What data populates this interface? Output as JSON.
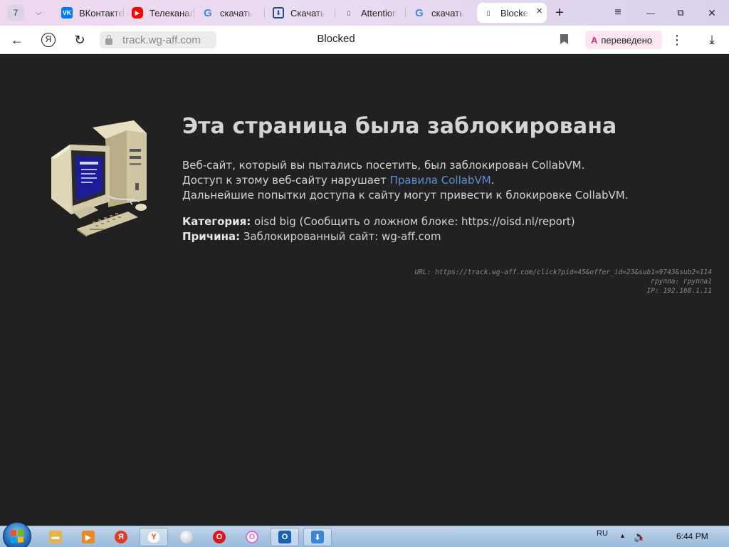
{
  "browser": {
    "tab_count": "7",
    "tabs": [
      {
        "title": "ВКонтакте",
        "icon": "vk-icon",
        "favicon_text": "VK"
      },
      {
        "title": "Телеканал",
        "icon": "youtube-icon",
        "favicon_text": "▶"
      },
      {
        "title": "скачать",
        "icon": "google-icon",
        "favicon_text": "G"
      },
      {
        "title": "Скачать",
        "icon": "download-site-icon",
        "favicon_text": "⬇"
      },
      {
        "title": "Attention",
        "icon": "page-icon",
        "favicon_text": "▯"
      },
      {
        "title": "скачать",
        "icon": "google-icon",
        "favicon_text": "G"
      },
      {
        "title": "Blocked",
        "icon": "page-icon",
        "favicon_text": "▯",
        "active": true
      }
    ],
    "new_tab_glyph": "+",
    "window_controls": {
      "menu": "≡",
      "minimize": "—",
      "restore": "⧉",
      "close": "✕"
    }
  },
  "addressbar": {
    "back": "←",
    "yandex": "Я",
    "reload": "↻",
    "host": "track.wg-aff.com",
    "page_title": "Blocked",
    "translate_badge": "переведено",
    "translate_icon": "A",
    "more": "⋮",
    "download": "⤓"
  },
  "page": {
    "title": "Эта страница была заблокирована",
    "line1": "Веб-сайт, который вы пытались посетить, был заблокирован CollabVM.",
    "line2_prefix": "Доступ к этому веб-сайту нарушает ",
    "line2_link": "Правила CollabVM",
    "line2_suffix": ".",
    "line3": "Дальнейшие попытки доступа к сайту могут привести к блокировке CollabVM.",
    "category_label": "Категория:",
    "category_value": " oisd big (Сообщить о ложном блоке: https://oisd.nl/report)",
    "reason_label": "Причина:",
    "reason_value": " Заблокированный сайт: wg-aff.com",
    "debug": {
      "url": "URL: https://track.wg-aff.com/click?pid=45&offer_id=23&sub1=9743&sub2=114",
      "group": "группа: группа1",
      "ip": "IP: 192.168.1.11"
    }
  },
  "taskbar": {
    "items": [
      {
        "name": "explorer",
        "icon": "folder-icon",
        "color": "#e8b24a",
        "glyph": "▬"
      },
      {
        "name": "media-player",
        "icon": "media-player-icon",
        "color": "#e98a22",
        "glyph": "▶"
      },
      {
        "name": "yandex-red",
        "icon": "yandex-icon",
        "color": "#e23a2b",
        "glyph": "Я"
      },
      {
        "name": "yandex-browser",
        "icon": "yandex-browser-icon",
        "color": "#ff3a2b",
        "glyph": "Y"
      },
      {
        "name": "generic-circle",
        "icon": "circle-app-icon",
        "color": "#c8ccd2",
        "glyph": "●"
      },
      {
        "name": "opera",
        "icon": "opera-icon",
        "color": "#e0141e",
        "glyph": "O"
      },
      {
        "name": "opera-gx",
        "icon": "opera-gx-icon",
        "color": "#d96bd9",
        "glyph": "O"
      },
      {
        "name": "outlook",
        "icon": "outlook-icon",
        "color": "#1860b8",
        "glyph": "O"
      },
      {
        "name": "downloader",
        "icon": "download-app-icon",
        "color": "#3a86d8",
        "glyph": "⬇"
      }
    ],
    "language": "RU",
    "tray_arrow": "▲",
    "clock": "6:44 PM"
  }
}
